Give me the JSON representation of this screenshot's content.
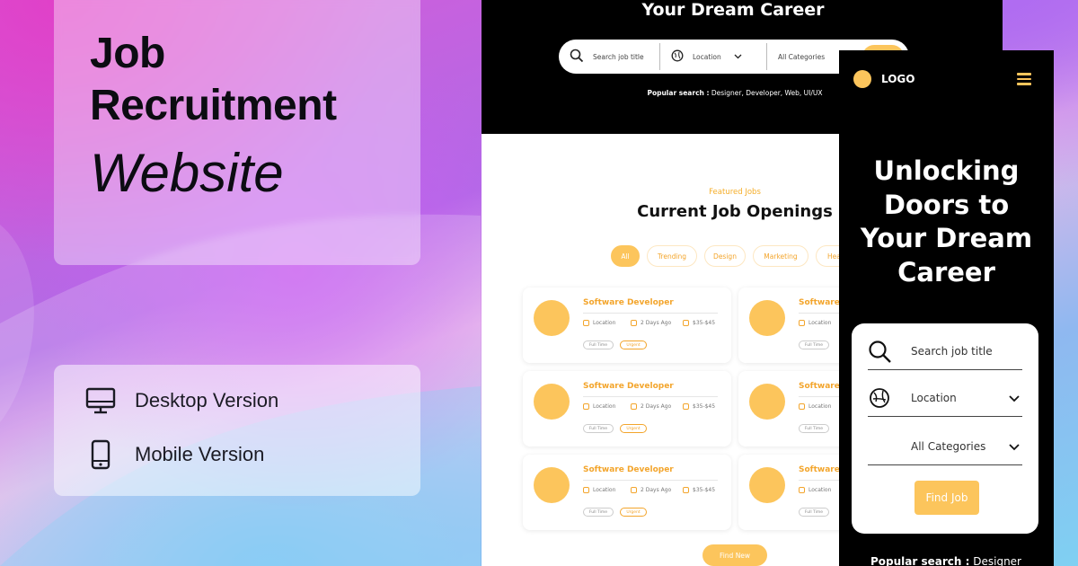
{
  "title_card": {
    "line1": "Job",
    "line2": "Recruitment",
    "line3": "Website"
  },
  "versions": [
    {
      "icon": "desktop-monitor-icon",
      "label": "Desktop Version"
    },
    {
      "icon": "mobile-phone-icon",
      "label": "Mobile Version"
    }
  ],
  "desktop": {
    "hero_title": "Your Dream Career",
    "search_placeholder": "Search job title",
    "location_label": "Location",
    "categories_label": "All Categories",
    "popular_label": "Popular search :",
    "popular_items": " Designer, Developer, Web, UI/UX",
    "featured_label": "Featured Jobs",
    "section_title": "Current Job Openings",
    "chips": [
      "All",
      "Trending",
      "Design",
      "Marketing",
      "Hea"
    ],
    "jobs": [
      {
        "title": "Software Developer",
        "location": "Location",
        "posted": "2 Days Ago",
        "salary": "$35-$45",
        "tag1": "Full Time",
        "tag2": "Urgent"
      },
      {
        "title": "Software",
        "location": "Location",
        "posted": "",
        "salary": "",
        "tag1": "Full Time",
        "tag2": ""
      },
      {
        "title": "Software Developer",
        "location": "Location",
        "posted": "2 Days Ago",
        "salary": "$35-$45",
        "tag1": "Full Time",
        "tag2": "Urgent"
      },
      {
        "title": "Software",
        "location": "Location",
        "posted": "",
        "salary": "",
        "tag1": "Full Time",
        "tag2": ""
      },
      {
        "title": "Software Developer",
        "location": "Location",
        "posted": "2 Days Ago",
        "salary": "$35-$45",
        "tag1": "Full Time",
        "tag2": "Urgent"
      },
      {
        "title": "Software",
        "location": "Location",
        "posted": "",
        "salary": "",
        "tag1": "Full Time",
        "tag2": ""
      }
    ],
    "find_new_label": "Find New"
  },
  "mobile": {
    "logo_text": "LOGO",
    "hero_title": "Unlocking Doors to Your Dream Career",
    "search_placeholder": "Search job title",
    "location_label": "Location",
    "categories_label": "All Categories",
    "find_job_label": "Find Job",
    "popular_label": "Popular search :",
    "popular_first": " Designer"
  },
  "colors": {
    "accent": "#fcc55c",
    "accent_text": "#f3a52c",
    "dark": "#000000"
  }
}
